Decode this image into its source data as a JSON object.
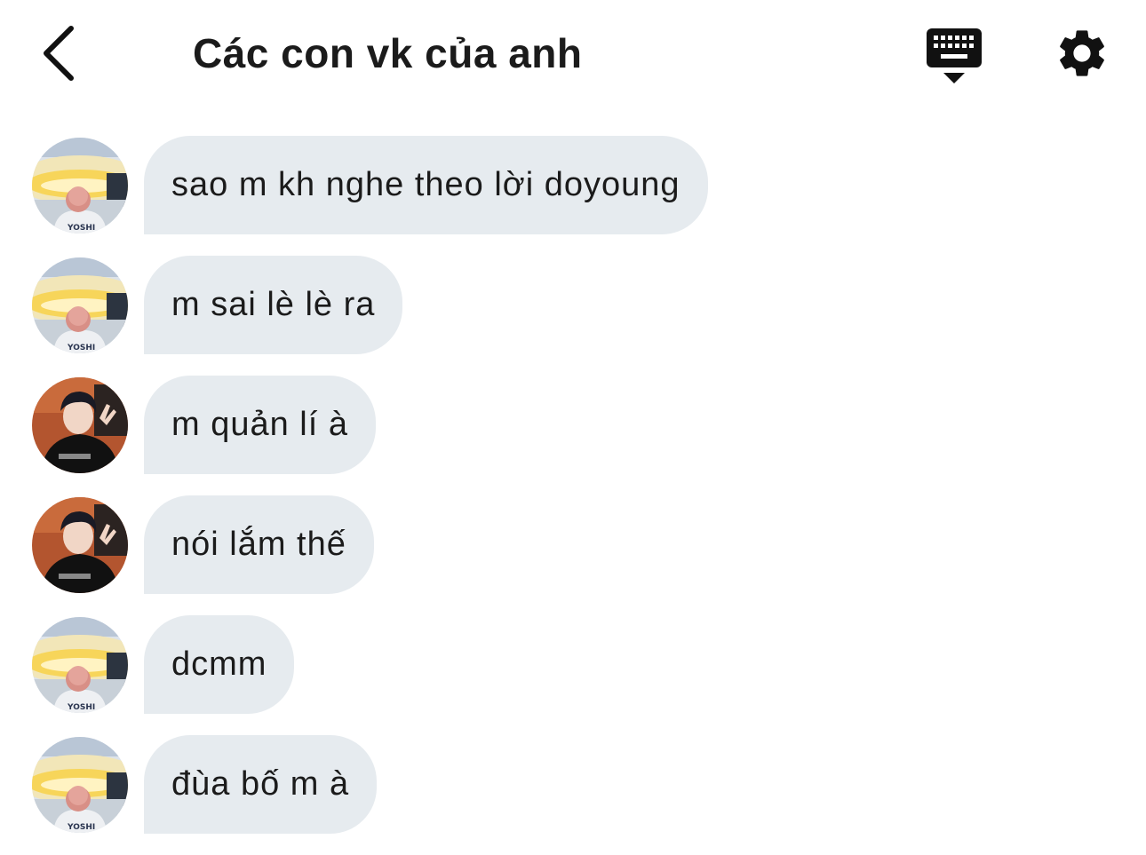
{
  "header": {
    "title": "Các con vk của anh",
    "back_icon": "chevron-left-icon",
    "keyboard_icon": "keyboard-hide-icon",
    "settings_icon": "gear-icon"
  },
  "messages": [
    {
      "text": " sao m kh nghe theo lời doyoung",
      "avatar": "yoshi-avatar"
    },
    {
      "text": "m sai lè lè ra",
      "avatar": "yoshi-avatar"
    },
    {
      "text": "m quản lí à",
      "avatar": "black-shirt-avatar"
    },
    {
      "text": "nói lắm thế",
      "avatar": "black-shirt-avatar"
    },
    {
      "text": "dcmm",
      "avatar": "yoshi-avatar"
    },
    {
      "text": "đùa bố m à",
      "avatar": "yoshi-avatar"
    }
  ],
  "colors": {
    "bubble_background": "#e6ebef",
    "text": "#1b1b1b",
    "background": "#ffffff"
  }
}
